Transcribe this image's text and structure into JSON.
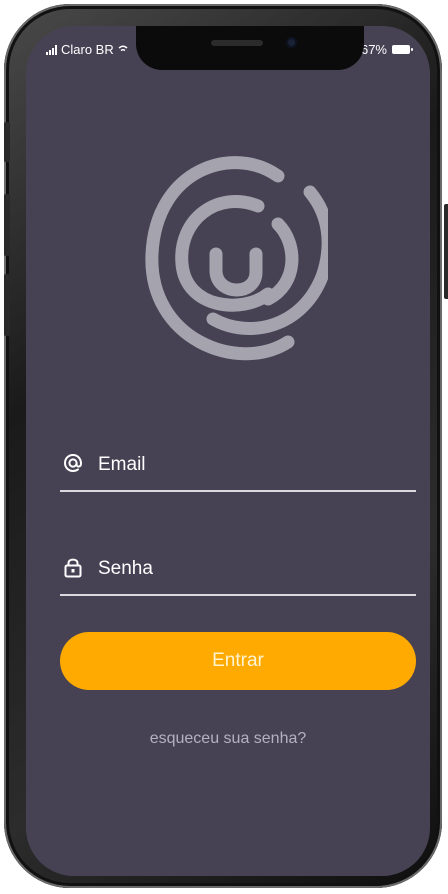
{
  "status_bar": {
    "carrier": "Claro BR",
    "battery": "67%",
    "signal_icon": "signal-bars-icon",
    "wifi_icon": "wifi-icon",
    "alarm_icon": "alarm-icon",
    "battery_icon": "battery-icon"
  },
  "logo": {
    "icon": "spiral-smile-logo",
    "color": "#a5a3ad"
  },
  "form": {
    "email": {
      "icon": "at-icon",
      "placeholder": "Email",
      "value": ""
    },
    "password": {
      "icon": "lock-icon",
      "placeholder": "Senha",
      "value": ""
    },
    "submit_label": "Entrar",
    "forgot_label": "esqueceu sua senha?"
  },
  "colors": {
    "background": "#464254",
    "accent": "#ffaa00",
    "text": "#ffffff",
    "muted": "#b4b0c2"
  }
}
